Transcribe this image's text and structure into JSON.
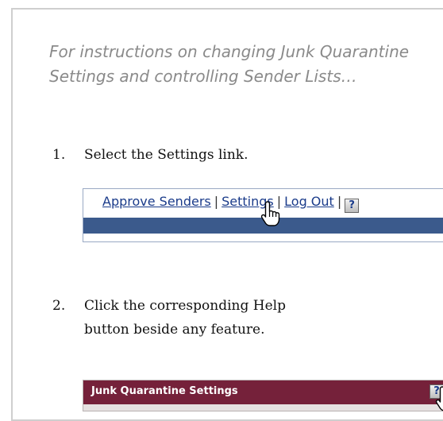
{
  "intro": "For instructions on changing Junk Quarantine Settings and controlling Sender Lists…",
  "steps": [
    {
      "number": "1.",
      "text": "Select the Settings link."
    },
    {
      "number": "2.",
      "text": "Click the corresponding Help button beside any feature."
    }
  ],
  "nav_example": {
    "links": [
      "Approve Senders",
      "Settings",
      "Log Out"
    ],
    "separator": "|",
    "help_label": "?"
  },
  "section_example": {
    "title": "Junk Quarantine Settings",
    "help_label": "?"
  },
  "colors": {
    "intro_text": "#8a8a8a",
    "link": "#1a3b8a",
    "nav_bar": "#3b5a8c",
    "section_bar": "#75213a"
  }
}
